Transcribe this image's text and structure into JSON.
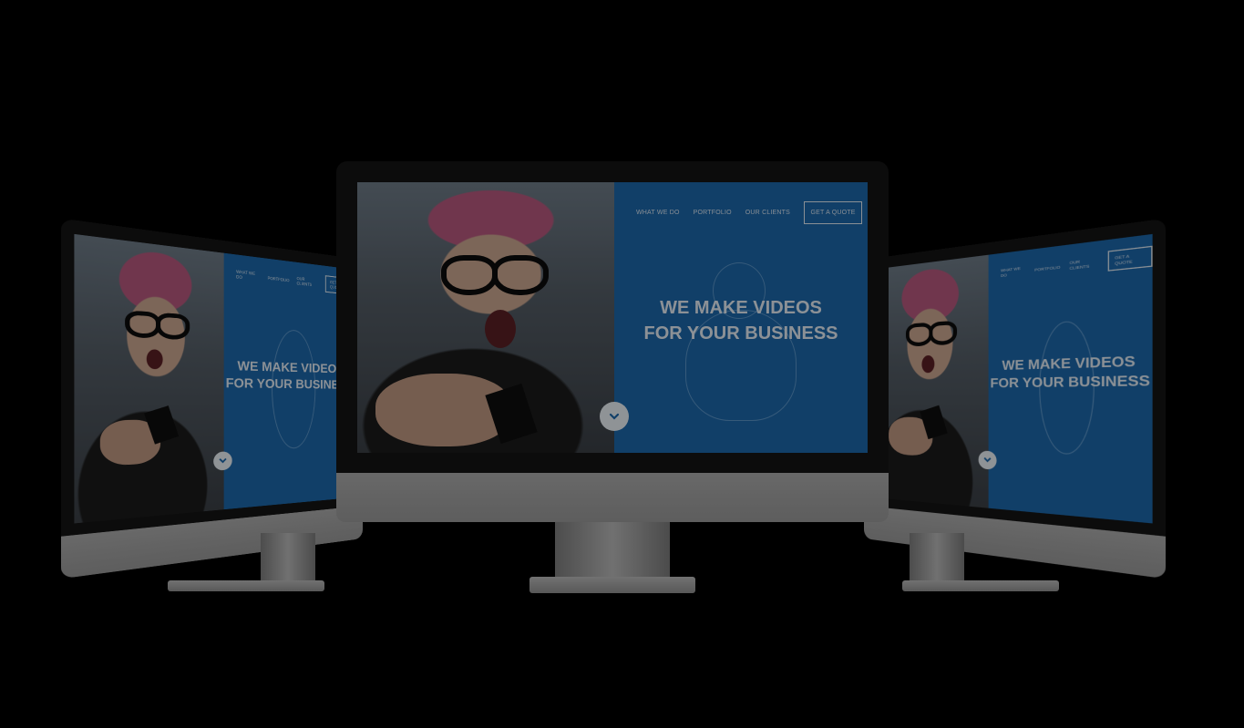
{
  "site": {
    "nav": {
      "items": [
        "WHAT WE DO",
        "PORTFOLIO",
        "OUR CLIENTS"
      ],
      "cta_label": "GET A QUOTE"
    },
    "hero": {
      "headline_line1": "WE MAKE VIDEOS",
      "headline_line2": "FOR YOUR BUSINESS",
      "scroll_icon": "chevron-down-icon"
    }
  },
  "theme": {
    "background": "#000000",
    "brand_blue": "#1c66a8",
    "bezel": "#141414",
    "aluminium": "#a9a9a9"
  }
}
